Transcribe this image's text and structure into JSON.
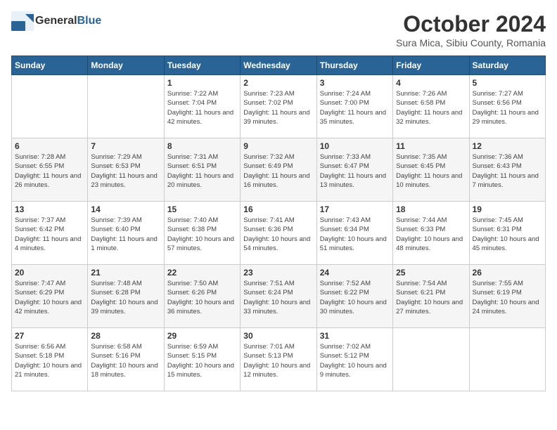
{
  "header": {
    "logo_general": "General",
    "logo_blue": "Blue",
    "month": "October 2024",
    "location": "Sura Mica, Sibiu County, Romania"
  },
  "weekdays": [
    "Sunday",
    "Monday",
    "Tuesday",
    "Wednesday",
    "Thursday",
    "Friday",
    "Saturday"
  ],
  "weeks": [
    [
      {
        "day": "",
        "content": ""
      },
      {
        "day": "",
        "content": ""
      },
      {
        "day": "1",
        "content": "Sunrise: 7:22 AM\nSunset: 7:04 PM\nDaylight: 11 hours and 42 minutes."
      },
      {
        "day": "2",
        "content": "Sunrise: 7:23 AM\nSunset: 7:02 PM\nDaylight: 11 hours and 39 minutes."
      },
      {
        "day": "3",
        "content": "Sunrise: 7:24 AM\nSunset: 7:00 PM\nDaylight: 11 hours and 35 minutes."
      },
      {
        "day": "4",
        "content": "Sunrise: 7:26 AM\nSunset: 6:58 PM\nDaylight: 11 hours and 32 minutes."
      },
      {
        "day": "5",
        "content": "Sunrise: 7:27 AM\nSunset: 6:56 PM\nDaylight: 11 hours and 29 minutes."
      }
    ],
    [
      {
        "day": "6",
        "content": "Sunrise: 7:28 AM\nSunset: 6:55 PM\nDaylight: 11 hours and 26 minutes."
      },
      {
        "day": "7",
        "content": "Sunrise: 7:29 AM\nSunset: 6:53 PM\nDaylight: 11 hours and 23 minutes."
      },
      {
        "day": "8",
        "content": "Sunrise: 7:31 AM\nSunset: 6:51 PM\nDaylight: 11 hours and 20 minutes."
      },
      {
        "day": "9",
        "content": "Sunrise: 7:32 AM\nSunset: 6:49 PM\nDaylight: 11 hours and 16 minutes."
      },
      {
        "day": "10",
        "content": "Sunrise: 7:33 AM\nSunset: 6:47 PM\nDaylight: 11 hours and 13 minutes."
      },
      {
        "day": "11",
        "content": "Sunrise: 7:35 AM\nSunset: 6:45 PM\nDaylight: 11 hours and 10 minutes."
      },
      {
        "day": "12",
        "content": "Sunrise: 7:36 AM\nSunset: 6:43 PM\nDaylight: 11 hours and 7 minutes."
      }
    ],
    [
      {
        "day": "13",
        "content": "Sunrise: 7:37 AM\nSunset: 6:42 PM\nDaylight: 11 hours and 4 minutes."
      },
      {
        "day": "14",
        "content": "Sunrise: 7:39 AM\nSunset: 6:40 PM\nDaylight: 11 hours and 1 minute."
      },
      {
        "day": "15",
        "content": "Sunrise: 7:40 AM\nSunset: 6:38 PM\nDaylight: 10 hours and 57 minutes."
      },
      {
        "day": "16",
        "content": "Sunrise: 7:41 AM\nSunset: 6:36 PM\nDaylight: 10 hours and 54 minutes."
      },
      {
        "day": "17",
        "content": "Sunrise: 7:43 AM\nSunset: 6:34 PM\nDaylight: 10 hours and 51 minutes."
      },
      {
        "day": "18",
        "content": "Sunrise: 7:44 AM\nSunset: 6:33 PM\nDaylight: 10 hours and 48 minutes."
      },
      {
        "day": "19",
        "content": "Sunrise: 7:45 AM\nSunset: 6:31 PM\nDaylight: 10 hours and 45 minutes."
      }
    ],
    [
      {
        "day": "20",
        "content": "Sunrise: 7:47 AM\nSunset: 6:29 PM\nDaylight: 10 hours and 42 minutes."
      },
      {
        "day": "21",
        "content": "Sunrise: 7:48 AM\nSunset: 6:28 PM\nDaylight: 10 hours and 39 minutes."
      },
      {
        "day": "22",
        "content": "Sunrise: 7:50 AM\nSunset: 6:26 PM\nDaylight: 10 hours and 36 minutes."
      },
      {
        "day": "23",
        "content": "Sunrise: 7:51 AM\nSunset: 6:24 PM\nDaylight: 10 hours and 33 minutes."
      },
      {
        "day": "24",
        "content": "Sunrise: 7:52 AM\nSunset: 6:22 PM\nDaylight: 10 hours and 30 minutes."
      },
      {
        "day": "25",
        "content": "Sunrise: 7:54 AM\nSunset: 6:21 PM\nDaylight: 10 hours and 27 minutes."
      },
      {
        "day": "26",
        "content": "Sunrise: 7:55 AM\nSunset: 6:19 PM\nDaylight: 10 hours and 24 minutes."
      }
    ],
    [
      {
        "day": "27",
        "content": "Sunrise: 6:56 AM\nSunset: 5:18 PM\nDaylight: 10 hours and 21 minutes."
      },
      {
        "day": "28",
        "content": "Sunrise: 6:58 AM\nSunset: 5:16 PM\nDaylight: 10 hours and 18 minutes."
      },
      {
        "day": "29",
        "content": "Sunrise: 6:59 AM\nSunset: 5:15 PM\nDaylight: 10 hours and 15 minutes."
      },
      {
        "day": "30",
        "content": "Sunrise: 7:01 AM\nSunset: 5:13 PM\nDaylight: 10 hours and 12 minutes."
      },
      {
        "day": "31",
        "content": "Sunrise: 7:02 AM\nSunset: 5:12 PM\nDaylight: 10 hours and 9 minutes."
      },
      {
        "day": "",
        "content": ""
      },
      {
        "day": "",
        "content": ""
      }
    ]
  ]
}
